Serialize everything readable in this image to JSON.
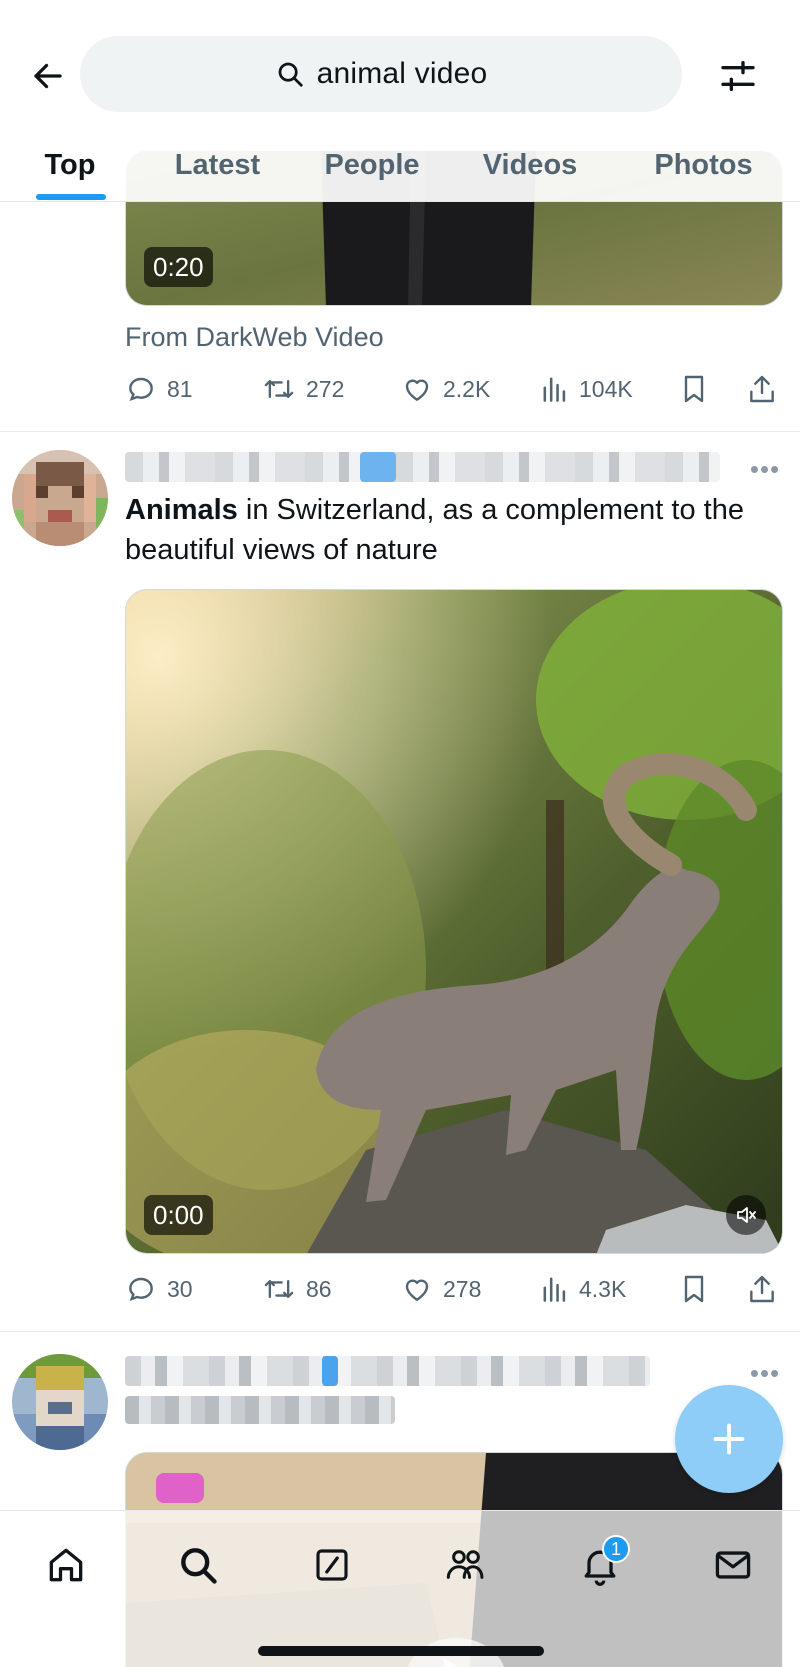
{
  "search": {
    "query": "animal video"
  },
  "tabs": [
    {
      "label": "Top"
    },
    {
      "label": "Latest"
    },
    {
      "label": "People"
    },
    {
      "label": "Videos"
    },
    {
      "label": "Photos"
    }
  ],
  "active_tab": "Top",
  "tweet1": {
    "duration": "0:20",
    "source": "From DarkWeb Video",
    "replies": "81",
    "retweets": "272",
    "likes": "2.2K",
    "views": "104K"
  },
  "tweet2": {
    "text_bold": "Animals",
    "text_rest": " in Switzerland, as a complement to the beautiful views of nature",
    "duration": "0:00",
    "replies": "30",
    "retweets": "86",
    "likes": "278",
    "views": "4.3K",
    "muted": true
  },
  "notifications_badge": "1",
  "colors": {
    "accent": "#1d9bf0",
    "text_primary": "#0f1419",
    "text_secondary": "#536471",
    "search_bg": "#eff3f4",
    "fab": "#8ecdf7"
  },
  "icons": {
    "header": [
      "back-arrow-icon",
      "search-icon",
      "filter-sliders-icon"
    ],
    "actions": [
      "reply-icon",
      "retweet-icon",
      "like-icon",
      "views-icon",
      "bookmark-icon",
      "share-icon"
    ],
    "nav": [
      "home-icon",
      "search-icon",
      "grok-icon",
      "communities-icon",
      "notifications-icon",
      "messages-icon"
    ],
    "fab": "plus-icon"
  }
}
